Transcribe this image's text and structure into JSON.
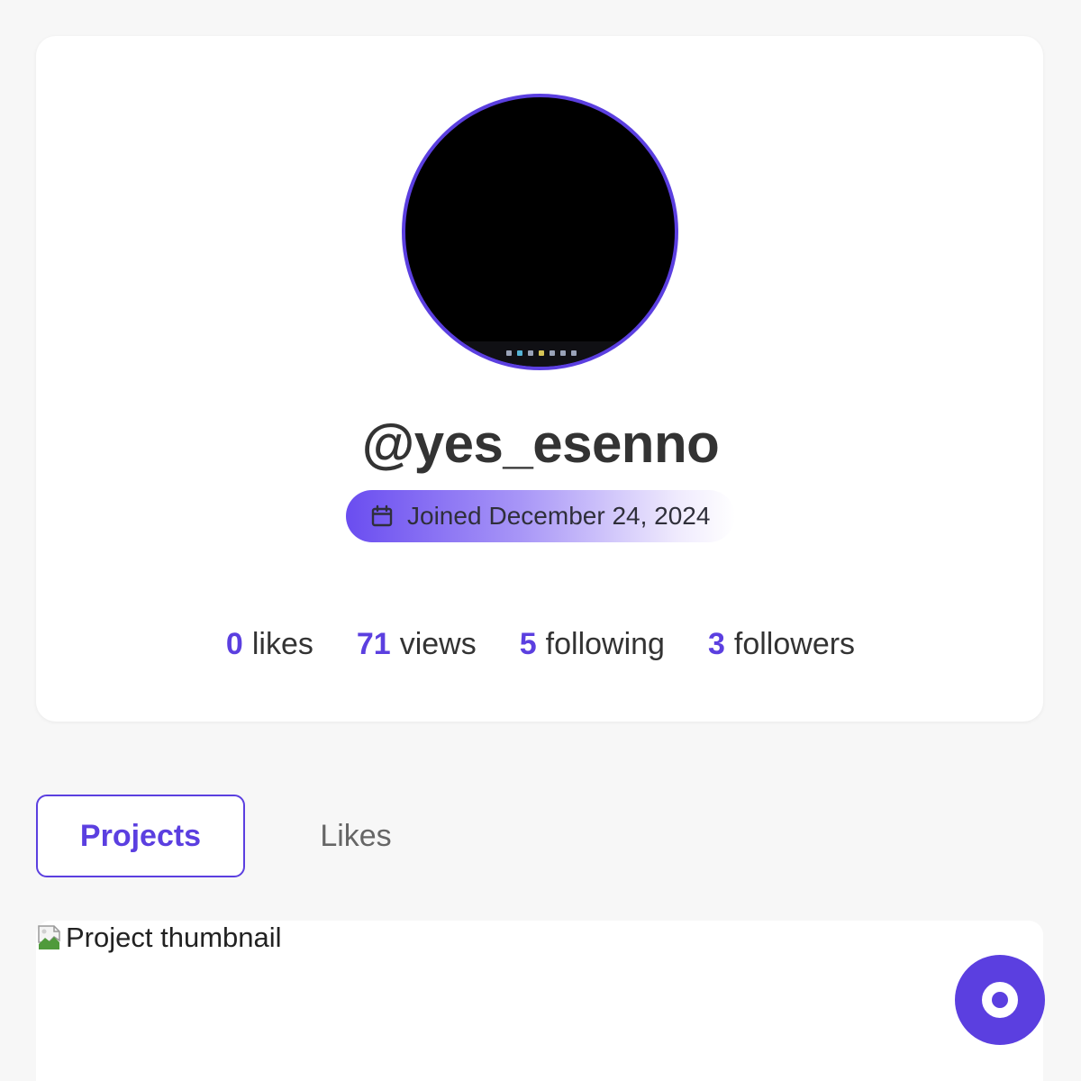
{
  "profile": {
    "username": "@yes_esenno",
    "avatar_alt": "Profile avatar",
    "joined_label": "Joined",
    "joined_date": "December 24, 2024"
  },
  "stats": [
    {
      "value": "0",
      "label": "likes"
    },
    {
      "value": "71",
      "label": "views"
    },
    {
      "value": "5",
      "label": "following"
    },
    {
      "value": "3",
      "label": "followers"
    }
  ],
  "tabs": {
    "projects": "Projects",
    "likes": "Likes",
    "active": "Projects"
  },
  "project": {
    "thumbnail_alt": "Project thumbnail"
  },
  "icons": {
    "calendar": "calendar-icon",
    "broken_image": "broken-image-icon",
    "fab": "record-icon"
  },
  "colors": {
    "accent": "#5b3fe0",
    "background": "#f7f7f7",
    "card": "#ffffff",
    "text": "#333333",
    "muted_text": "#666666"
  }
}
